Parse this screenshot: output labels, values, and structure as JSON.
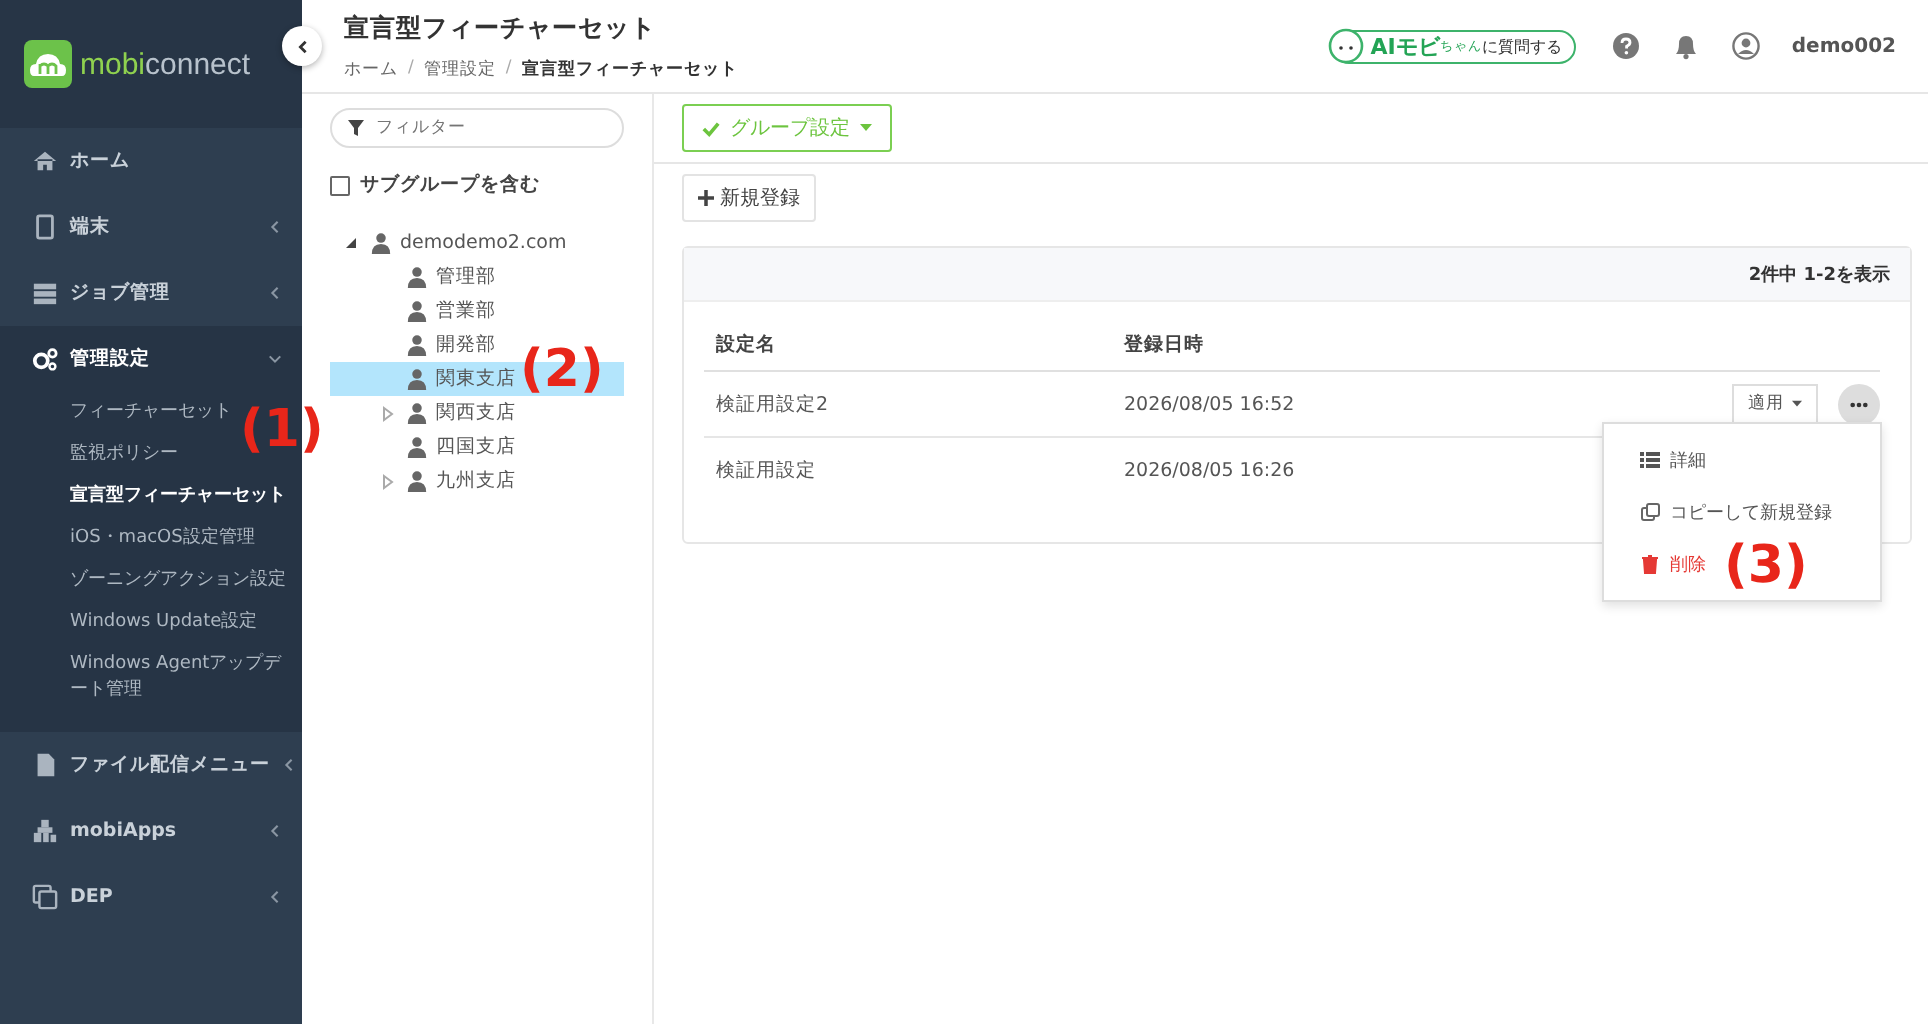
{
  "sidebar": {
    "logo": {
      "first": "mobi",
      "second": "connect"
    },
    "items": [
      {
        "label": "ホーム",
        "expandable": false,
        "expanded": false
      },
      {
        "label": "端末",
        "expandable": true,
        "expanded": false
      },
      {
        "label": "ジョブ管理",
        "expandable": true,
        "expanded": false
      },
      {
        "label": "管理設定",
        "expandable": true,
        "expanded": true,
        "children": [
          {
            "label": "フィーチャーセット",
            "selected": false
          },
          {
            "label": "監視ポリシー",
            "selected": false
          },
          {
            "label": "宣言型フィーチャーセット",
            "selected": true
          },
          {
            "label": "iOS・macOS設定管理",
            "selected": false
          },
          {
            "label": "ゾーニングアクション設定",
            "selected": false
          },
          {
            "label": "Windows Update設定",
            "selected": false
          },
          {
            "label": "Windows Agentアップデート管理",
            "selected": false
          }
        ]
      },
      {
        "label": "ファイル配信メニュー",
        "expandable": true,
        "expanded": false
      },
      {
        "label": "mobiApps",
        "expandable": true,
        "expanded": false
      },
      {
        "label": "DEP",
        "expandable": true,
        "expanded": false
      }
    ]
  },
  "header": {
    "title": "宣言型フィーチャーセット",
    "breadcrumb": [
      "ホーム",
      "管理設定",
      "宣言型フィーチャーセット"
    ],
    "breadcrumb_separator": "/",
    "ai_button": {
      "main": "AIモビ",
      "small": "ちゃん",
      "rest": "に質問する"
    },
    "user": "demo002"
  },
  "tree_panel": {
    "filter": {
      "placeholder": "フィルター"
    },
    "include_subgroups": {
      "label": "サブグループを含む",
      "checked": false
    },
    "tree": [
      {
        "label": "demodemo2.com",
        "expandable": true,
        "expanded": true,
        "selected": false,
        "children": [
          {
            "label": "管理部",
            "expandable": false,
            "selected": false
          },
          {
            "label": "営業部",
            "expandable": false,
            "selected": false
          },
          {
            "label": "開発部",
            "expandable": false,
            "selected": false
          },
          {
            "label": "関東支店",
            "expandable": false,
            "selected": true
          },
          {
            "label": "関西支店",
            "expandable": true,
            "expanded": false,
            "selected": false
          },
          {
            "label": "四国支店",
            "expandable": false,
            "selected": false
          },
          {
            "label": "九州支店",
            "expandable": true,
            "expanded": false,
            "selected": false
          }
        ]
      }
    ]
  },
  "toolbar": {
    "group_button": "グループ設定",
    "new_button": "新規登録"
  },
  "table": {
    "summary": "2件中 1-2を表示",
    "columns": [
      "設定名",
      "登録日時"
    ],
    "rows": [
      {
        "name": "検証用設定2",
        "date": "2026/08/05 16:52",
        "apply_button": "適用",
        "menu_open": true
      },
      {
        "name": "検証用設定",
        "date": "2026/08/05 16:26"
      }
    ]
  },
  "row_menu": {
    "items": [
      {
        "label": "詳細",
        "kind": "normal"
      },
      {
        "label": "コピーして新規登録",
        "kind": "normal"
      },
      {
        "label": "削除",
        "kind": "danger"
      }
    ]
  },
  "annotations": [
    "(1)",
    "(2)",
    "(3)"
  ]
}
